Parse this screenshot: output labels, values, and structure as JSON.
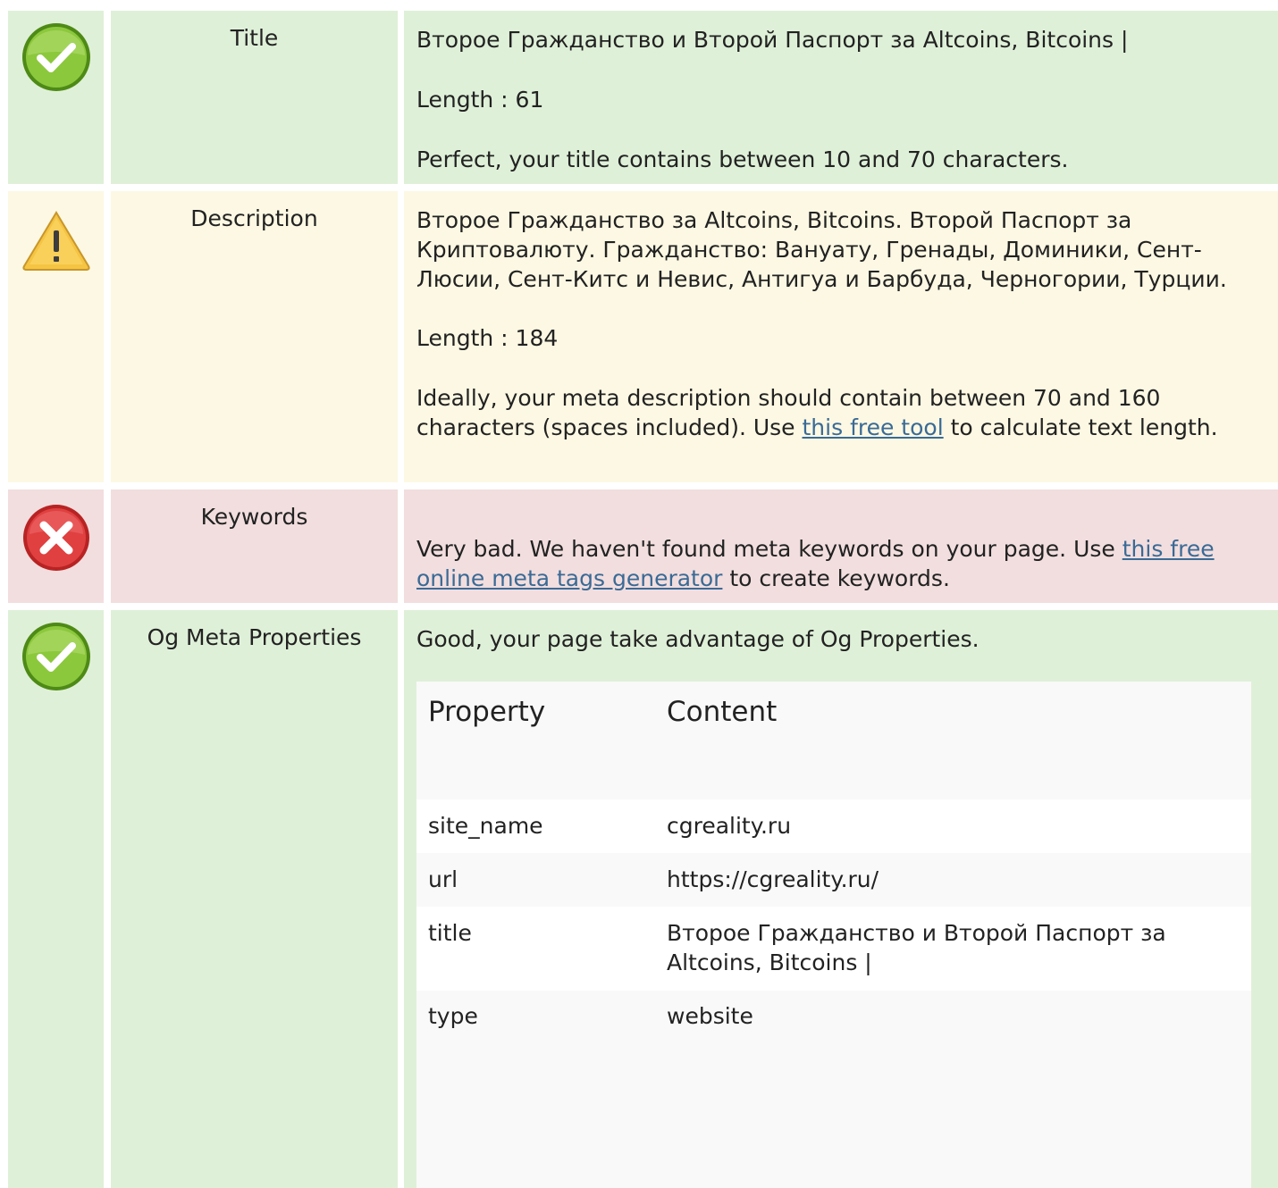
{
  "rows": {
    "title": {
      "label": "Title",
      "status": "success",
      "value": "Второе Гражданство и Второй Паспорт за Altcoins, Bitcoins | ",
      "length": "Length : 61",
      "message": "Perfect, your title contains between 10 and 70 characters."
    },
    "description": {
      "label": "Description",
      "status": "warning",
      "value": "Второе Гражданство за Altcoins, Bitcoins. Второй Паспорт за Криптовалюту. Гражданство: Вануату, Гренады, Доминики, Сент-Люсии, Сент-Китс и Невис, Антигуа и Барбуда, Черногории, Турции.",
      "length": "Length : 184",
      "message_before": "Ideally, your meta description should contain between 70 and 160 characters (spaces included). Use ",
      "link_text": "this free tool",
      "message_after": " to calculate text length."
    },
    "keywords": {
      "label": "Keywords",
      "status": "error",
      "message_before": "Very bad. We haven't found meta keywords on your page. Use ",
      "link_text": "this free online meta tags generator",
      "message_after": " to create keywords."
    },
    "og": {
      "label": "Og Meta Properties",
      "status": "success",
      "message": "Good, your page take advantage of Og Properties.",
      "table": {
        "header": {
          "property": "Property",
          "content": "Content"
        },
        "rows": [
          {
            "property": "site_name",
            "content": "cgreality.ru"
          },
          {
            "property": "url",
            "content": "https://cgreality.ru/"
          },
          {
            "property": "title",
            "content": "Второе Гражданство и Второй Паспорт за Altcoins, Bitcoins | "
          },
          {
            "property": "type",
            "content": "website"
          }
        ]
      }
    }
  },
  "colors": {
    "success_bg": "#dff0d8",
    "warning_bg": "#fcf8e3",
    "error_bg": "#f2dede",
    "link": "#3a6a96"
  },
  "icons": {
    "success": "check-circle-icon",
    "warning": "warning-triangle-icon",
    "error": "close-circle-icon"
  }
}
